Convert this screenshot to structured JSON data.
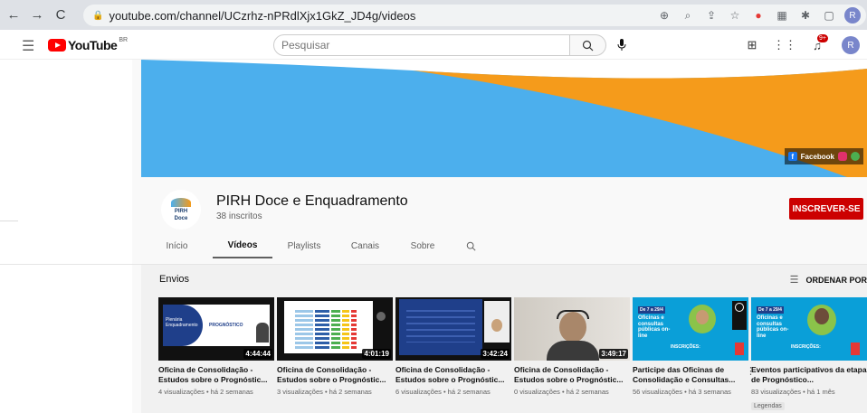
{
  "browser": {
    "url": "youtube.com/channel/UCzrhz-nPRdlXjx1GkZ_JD4g/videos",
    "profile_initial": "R"
  },
  "header": {
    "logo_text": "YouTube",
    "logo_region": "BR",
    "search_placeholder": "Pesquisar",
    "notif_count": "9+",
    "avatar_initial": "R"
  },
  "channel": {
    "name": "PIRH Doce e Enquadramento",
    "subscribers": "38 inscritos",
    "avatar_text_1": "PIRH",
    "avatar_text_2": "Doce",
    "subscribe_label": "INSCREVER-SE",
    "social_label": "Facebook"
  },
  "tabs": [
    {
      "label": "Início"
    },
    {
      "label": "Vídeos"
    },
    {
      "label": "Playlists"
    },
    {
      "label": "Canais"
    },
    {
      "label": "Sobre"
    }
  ],
  "section": {
    "title": "Envios",
    "sort_label": "ORDENAR POR"
  },
  "videos": [
    {
      "title": "Oficina de Consolidação - Estudos sobre o Prognóstic...",
      "meta": "4 visualizações • há 2 semanas",
      "duration": "4:44:44",
      "thumb_text_1": "Plenária Enquadramento",
      "thumb_text_2": "PROGNÓSTICO"
    },
    {
      "title": "Oficina de Consolidação - Estudos sobre o Prognóstic...",
      "meta": "3 visualizações • há 2 semanas",
      "duration": "4:01:19"
    },
    {
      "title": "Oficina de Consolidação - Estudos sobre o Prognóstic...",
      "meta": "6 visualizações • há 2 semanas",
      "duration": "3:42:24"
    },
    {
      "title": "Oficina de Consolidação - Estudos sobre o Prognóstic...",
      "meta": "0 visualizações • há 2 semanas",
      "duration": "3:49:17"
    },
    {
      "title": "Participe das Oficinas de Consolidação e Consultas...",
      "meta": "56 visualizações • há 3 semanas",
      "thumb_date": "De 7 a 29/4",
      "thumb_text_1": "Oficinas e consultas públicas on-line",
      "thumb_text_2": "INSCRIÇÕES:"
    },
    {
      "title": "Eventos participativos da etapa de Prognóstico...",
      "meta": "83 visualizações • há 1 mês",
      "badge": "Legendas",
      "thumb_date": "De 7 a 29/4",
      "thumb_text_1": "Oficinas e consultas públicas on-line",
      "thumb_text_2": "INSCRIÇÕES:"
    }
  ]
}
